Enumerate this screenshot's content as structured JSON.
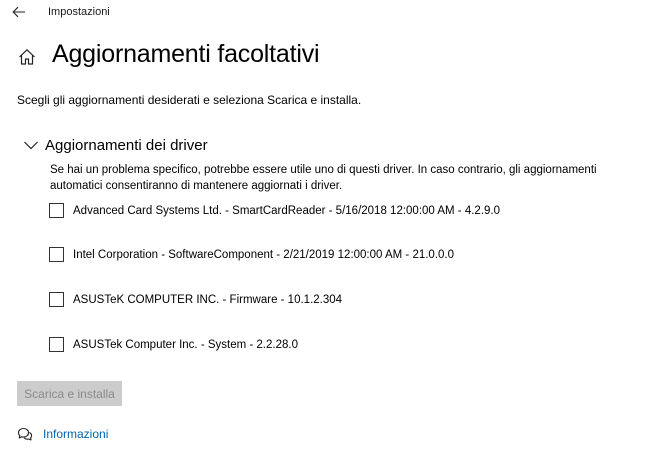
{
  "titlebar": {
    "app_title": "Impostazioni"
  },
  "page": {
    "title": "Aggiornamenti facoltativi"
  },
  "intro": "Scegli gli aggiornamenti desiderati e seleziona Scarica e installa.",
  "section": {
    "title": "Aggiornamenti dei driver",
    "expanded": true,
    "description": "Se hai un problema specifico, potrebbe essere utile uno di questi driver. In caso contrario, gli aggiornamenti automatici consentiranno di mantenere aggiornati i driver."
  },
  "drivers": [
    {
      "label": "Advanced Card Systems Ltd. - SmartCardReader - 5/16/2018 12:00:00 AM - 4.2.9.0",
      "checked": false
    },
    {
      "label": "Intel Corporation - SoftwareComponent - 2/21/2019 12:00:00 AM - 21.0.0.0",
      "checked": false
    },
    {
      "label": "ASUSTeK COMPUTER INC. - Firmware - 10.1.2.304",
      "checked": false
    },
    {
      "label": "ASUSTek Computer Inc. - System - 2.2.28.0",
      "checked": false
    }
  ],
  "actions": {
    "install_label": "Scarica e installa",
    "install_enabled": false
  },
  "footer": {
    "info_label": "Informazioni"
  },
  "colors": {
    "link": "#0063b1",
    "disabled_button_bg": "#cccccc",
    "disabled_button_text": "#8a8a8a"
  },
  "icons": {
    "back": "back-arrow-icon",
    "home": "home-icon",
    "chevron": "chevron-down-icon",
    "info": "chat-help-icon"
  }
}
